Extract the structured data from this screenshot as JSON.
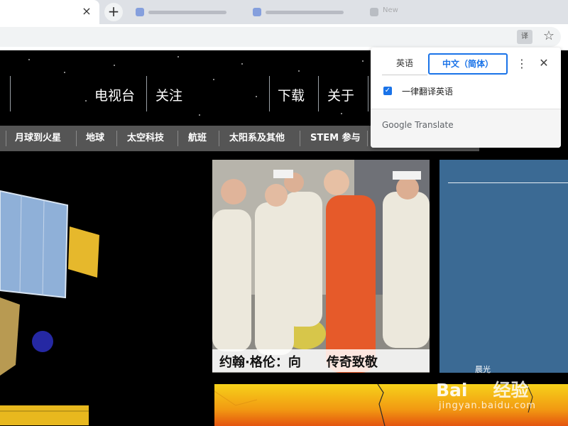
{
  "browser": {
    "active_tab_close": "×",
    "new_tab": "+",
    "background_tab_label": "New",
    "star": "☆",
    "translate_icon_glyph": "译"
  },
  "site": {
    "top_nav": [
      "电视台",
      "关注",
      "下载",
      "关于"
    ],
    "sub_nav": [
      "月球到火星",
      "地球",
      "太空科技",
      "航班",
      "太阳系及其他",
      "STEM 参与"
    ],
    "feature_caption_part1": "约翰·格伦：向",
    "feature_caption_part2": "传奇致敬",
    "panel_label": "晨光"
  },
  "translate_popup": {
    "source_lang": "英语",
    "target_lang": "中文（简体）",
    "always_translate_label": "一律翻译英语",
    "always_translate_checked": true,
    "brand": "Google Translate",
    "menu_icon": "⋮",
    "close_icon": "✕",
    "accent_color": "#1a73e8"
  },
  "watermark": {
    "logo": "Bai",
    "logo_suffix": "经验",
    "url": "jingyan.baidu.com"
  }
}
